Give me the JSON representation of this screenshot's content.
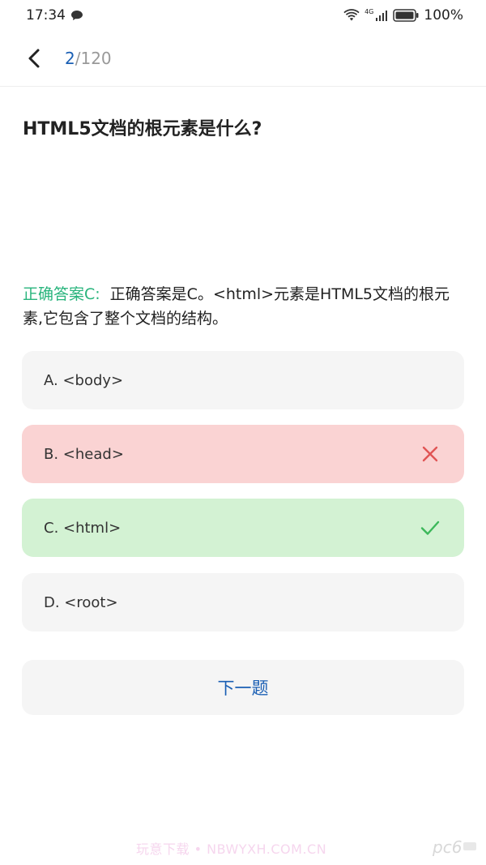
{
  "status_bar": {
    "time": "17:34",
    "network": "4G",
    "battery": "100%"
  },
  "header": {
    "current": "2",
    "total": "/120"
  },
  "question": {
    "text": "HTML5文档的根元素是什么?"
  },
  "explanation": {
    "label": "正确答案C:",
    "text": "正确答案是C。<html>元素是HTML5文档的根元素,它包含了整个文档的结构。"
  },
  "options": [
    {
      "label": "A. <body>",
      "state": "normal"
    },
    {
      "label": "B. <head>",
      "state": "wrong"
    },
    {
      "label": "C. <html>",
      "state": "correct"
    },
    {
      "label": "D. <root>",
      "state": "normal"
    }
  ],
  "next_button": {
    "label": "下一题"
  },
  "watermark": {
    "text": "玩意下载 • NBWYXH.COM.CN",
    "logo_text": "pc6"
  },
  "colors": {
    "accent": "#1a5fb4",
    "answer_label": "#28b47c",
    "wrong_bg": "#fad3d3",
    "correct_bg": "#d3f2d3",
    "wrong_mark": "#e05555",
    "correct_mark": "#3cb85a"
  }
}
